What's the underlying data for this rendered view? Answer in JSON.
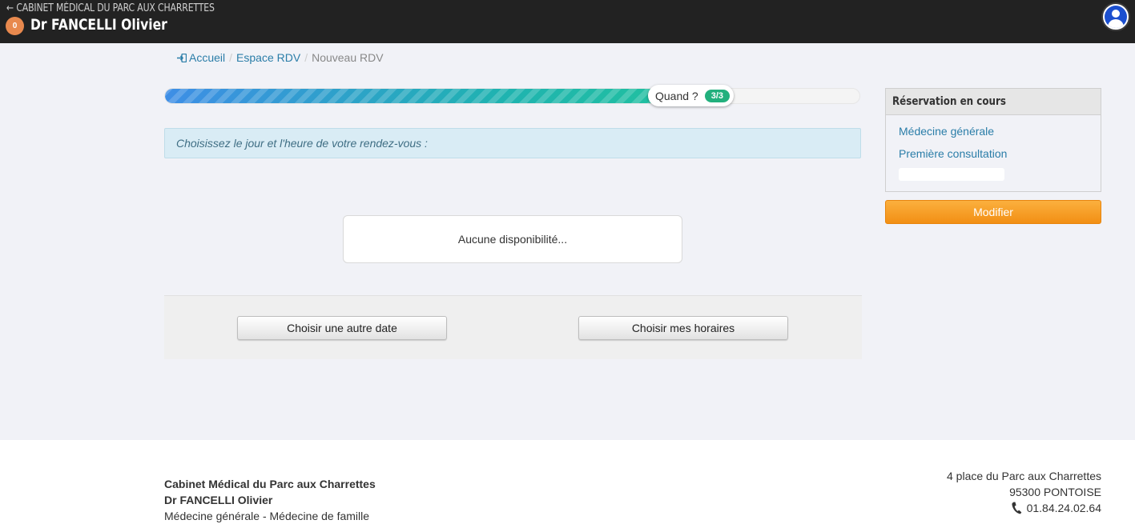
{
  "topbar": {
    "back_label": "CABINET MÉDICAL DU PARC AUX CHARRETTES",
    "badge_count": "0",
    "doctor_name": "Dr FANCELLI Olivier"
  },
  "breadcrumb": {
    "home": "Accueil",
    "space": "Espace RDV",
    "current": "Nouveau RDV"
  },
  "progress": {
    "percent": 81,
    "label": "Quand ?",
    "step": "3/3"
  },
  "main": {
    "instruction": "Choisissez le jour et l'heure de votre rendez-vous :",
    "no_availability": "Aucune disponibilité...",
    "btn_other_date": "Choisir une autre date",
    "btn_my_hours": "Choisir mes horaires"
  },
  "sidebar": {
    "title": "Réservation en cours",
    "specialty": "Médecine générale",
    "consultation": "Première consultation",
    "modify_label": "Modifier"
  },
  "footer": {
    "cabinet": "Cabinet Médical du Parc aux Charrettes",
    "doctor": "Dr FANCELLI Olivier",
    "specialties": "Médecine générale - Médecine de famille",
    "address_line1": "4 place du Parc aux Charrettes",
    "address_line2": "95300 PONTOISE",
    "phone": "01.84.24.02.64"
  },
  "colors": {
    "topbar": "#222222",
    "accent_orange": "#f7a02a",
    "link_blue": "#2a7da8",
    "step_badge": "#22b07d"
  }
}
